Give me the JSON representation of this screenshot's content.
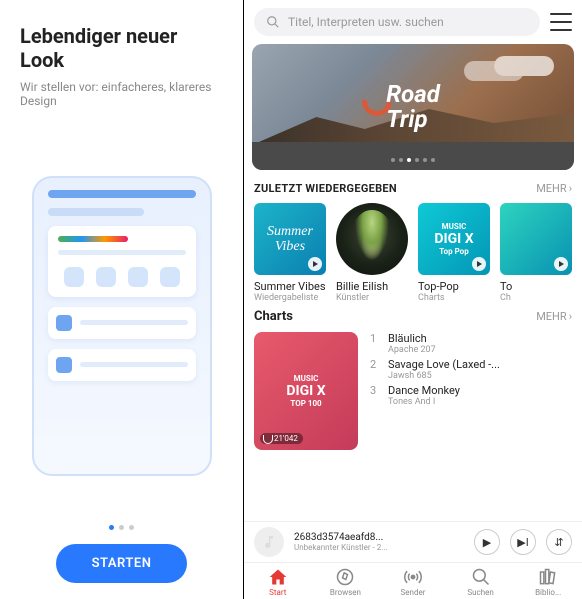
{
  "left": {
    "title": "Lebendiger neuer Look",
    "subtitle": "Wir stellen vor: einfacheres, klareres Design",
    "start_label": "STARTEN"
  },
  "right": {
    "search_placeholder": "Titel, Interpreten usw. suchen",
    "banner": {
      "line1": "Road",
      "line2": "Trip"
    },
    "recent": {
      "heading": "ZULETZT WIEDERGEGEBEN",
      "more": "MEHR",
      "items": [
        {
          "name": "Summer Vibes",
          "subtitle": "Wiedergabeliste"
        },
        {
          "name": "Billie Eilish",
          "subtitle": "Künstler"
        },
        {
          "name": "Top-Pop",
          "subtitle": "Charts",
          "card_line1": "DIGI X",
          "card_line2": "Top Pop"
        },
        {
          "name": "To",
          "subtitle": "Ch"
        }
      ]
    },
    "charts": {
      "heading": "Charts",
      "more": "MEHR",
      "card_line1": "DIGI X",
      "card_line2": "TOP 100",
      "duration": "21'042",
      "tracks": [
        {
          "n": "1",
          "title": "Bläulich",
          "artist": "Apache 207"
        },
        {
          "n": "2",
          "title": "Savage Love (Laxed -...",
          "artist": "Jawsh 685"
        },
        {
          "n": "3",
          "title": "Dance Monkey",
          "artist": "Tones And I"
        }
      ]
    },
    "player": {
      "title": "2683d3574aeafd8...",
      "artist": "Unbekannter Künstler - 2..."
    },
    "nav": {
      "start": "Start",
      "browse": "Browsen",
      "sender": "Sender",
      "search": "Suchen",
      "library": "Biblio..."
    }
  }
}
